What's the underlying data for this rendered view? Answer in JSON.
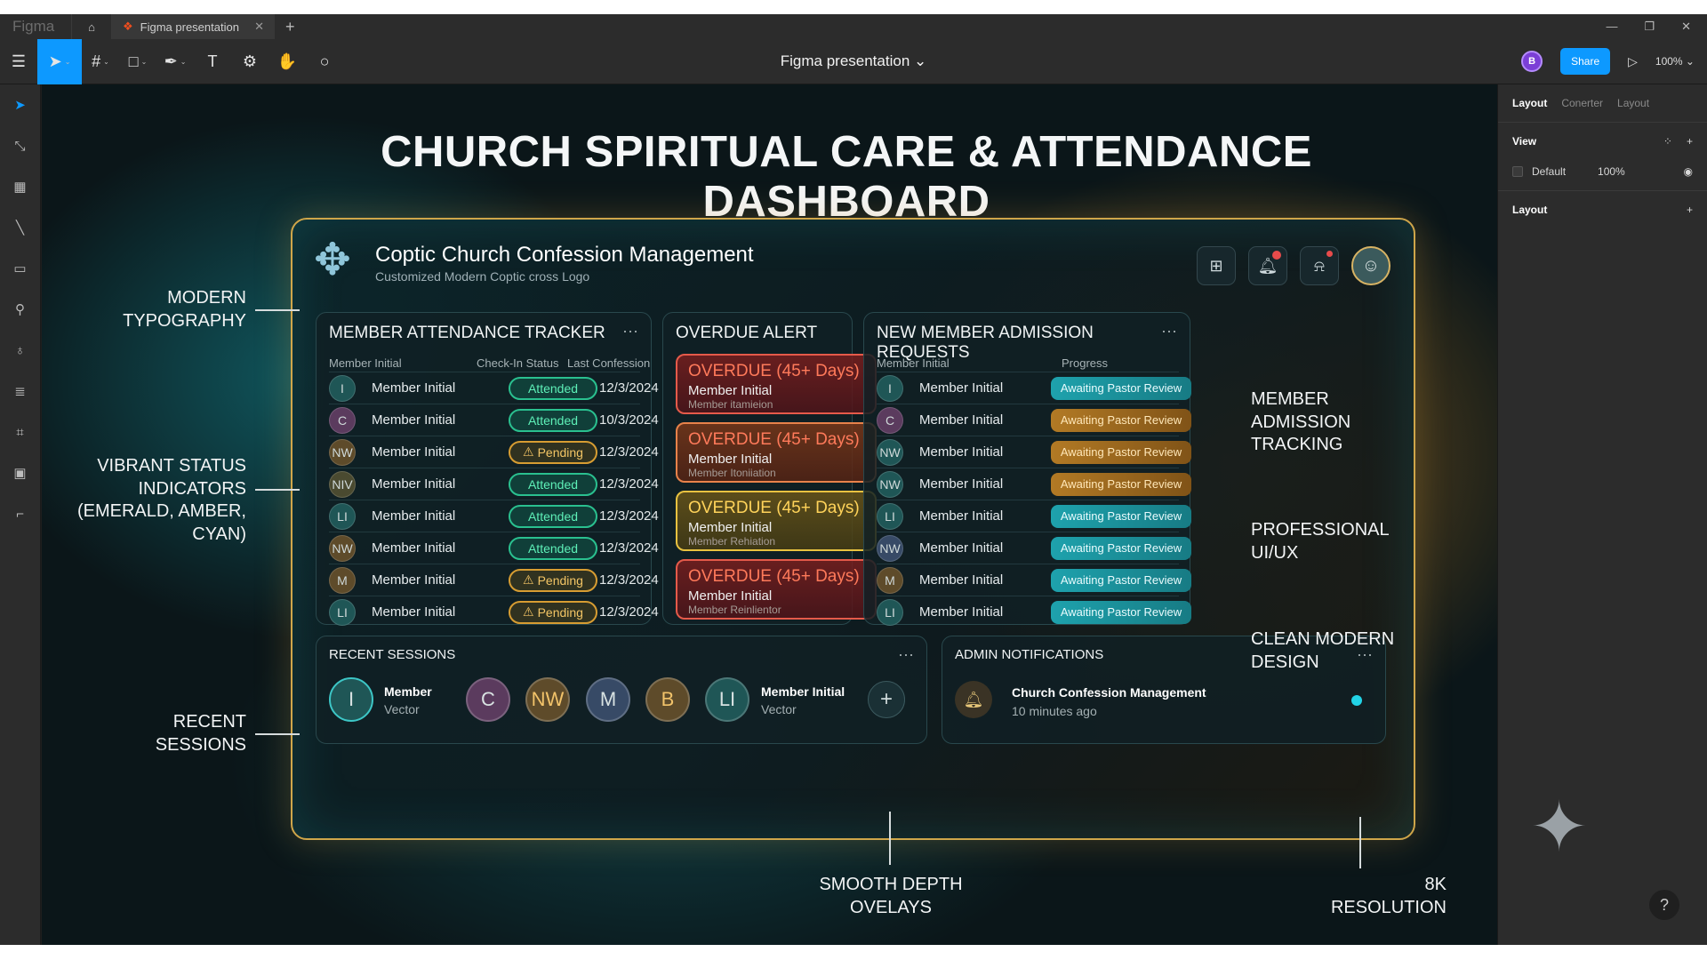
{
  "titlebar": {
    "logo": "Figma",
    "tab": "Figma presentation",
    "tab_close": "✕",
    "new_tab": "+",
    "minimize": "—",
    "maximize": "❐",
    "close": "✕"
  },
  "toolbar": {
    "doc_title": "Figma presentation ⌄",
    "user_initial": "B",
    "share": "Share",
    "play": "▷",
    "zoom": "100% ⌄"
  },
  "right_panel": {
    "tabs": [
      "Layout",
      "Conerter",
      "Layout"
    ],
    "view_label": "View",
    "default_label": "Default",
    "default_value": "100%",
    "layout_label": "Layout",
    "help": "?"
  },
  "canvas": {
    "main_title": "CHURCH SPIRITUAL CARE & ATTENDANCE DASHBOARD",
    "header": {
      "title": "Coptic Church Confession Management",
      "subtitle": "Customized Modern Coptic cross Logo"
    },
    "attendance": {
      "title": "MEMBER ATTENDANCE TRACKER",
      "col_member": "Member Initial",
      "col_status": "Check-In Status",
      "col_date": "Last Confession",
      "rows": [
        {
          "initial": "I",
          "name": "Member Initial",
          "status": "Attended",
          "date": "12/3/2024"
        },
        {
          "initial": "C",
          "name": "Member Initial",
          "status": "Attended",
          "date": "10/3/2024"
        },
        {
          "initial": "NW",
          "name": "Member Initial",
          "status": "Pending",
          "date": "12/3/2024"
        },
        {
          "initial": "NIV",
          "name": "Member Initial",
          "status": "Attended",
          "date": "12/3/2024"
        },
        {
          "initial": "LI",
          "name": "Member Initial",
          "status": "Attended",
          "date": "12/3/2024"
        },
        {
          "initial": "NW",
          "name": "Member Initial",
          "status": "Attended",
          "date": "12/3/2024"
        },
        {
          "initial": "M",
          "name": "Member Initial",
          "status": "Pending",
          "date": "12/3/2024"
        },
        {
          "initial": "LI",
          "name": "Member Initial",
          "status": "Pending",
          "date": "12/3/2024"
        }
      ]
    },
    "overdue": {
      "title": "OVERDUE ALERT",
      "cards": [
        {
          "title": "OVERDUE (45+ Days)",
          "name": "Member Initial",
          "sub": "Member itamieion"
        },
        {
          "title": "OVERDUE (45+ Days)",
          "name": "Member Initial",
          "sub": "Member Itoniiation"
        },
        {
          "title": "OVERDUE (45+ Days)",
          "name": "Member Initial",
          "sub": "Member Rehiation"
        },
        {
          "title": "OVERDUE (45+ Days)",
          "name": "Member Initial",
          "sub": "Member Reinlientor"
        }
      ]
    },
    "admission": {
      "title": "NEW MEMBER ADMISSION REQUESTS",
      "col_member": "Member Initial",
      "col_progress": "Progress",
      "rows": [
        {
          "initial": "I",
          "name": "Member Initial",
          "progress": "Awaiting Pastor Review"
        },
        {
          "initial": "C",
          "name": "Member Initial",
          "progress": "Awaiting Pastor Review"
        },
        {
          "initial": "NW",
          "name": "Member Initial",
          "progress": "Awaiting Pastor Review"
        },
        {
          "initial": "NW",
          "name": "Member Initial",
          "progress": "Awaiting Pastor Review"
        },
        {
          "initial": "LI",
          "name": "Member Initial",
          "progress": "Awaiting Pastor Review"
        },
        {
          "initial": "NW",
          "name": "Member Initial",
          "progress": "Awaiting Pastor Review"
        },
        {
          "initial": "M",
          "name": "Member Initial",
          "progress": "Awaiting Pastor Review"
        },
        {
          "initial": "LI",
          "name": "Member Initial",
          "progress": "Awaiting Pastor Review"
        }
      ]
    },
    "recent": {
      "title": "RECENT SESSIONS",
      "first_initial": "I",
      "first_name": "Member",
      "first_sub": "Vector",
      "avatars": [
        "C",
        "NW",
        "M",
        "B",
        "LI"
      ],
      "last_name": "Member Initial",
      "last_sub": "Vector",
      "add": "+"
    },
    "notifications": {
      "title": "ADMIN NOTIFICATIONS",
      "item_title": "Church Confession Management",
      "item_time": "10 minutes ago"
    },
    "more": "···",
    "callouts": {
      "typography": "MODERN\nTYPOGRAPHY",
      "status": "VIBRANT STATUS\nINDICATORS\n(EMERALD, AMBER,\nCYAN)",
      "recent": "RECENT\nSESSIONS",
      "admission": "MEMBER\nADMISSION\nTRACKING",
      "professional": "PROFESSIONAL\nUI/UX",
      "clean": "CLEAN MODERN\nDESIGN",
      "depth": "SMOOTH DEPTH\nOVELAYS",
      "resolution": "8K\nRESOLUTION"
    }
  },
  "colors": {
    "accent": "#0d99ff",
    "emerald": "#2ac08f",
    "amber": "#d79d32",
    "cyan": "#22d3e6",
    "overdue_red": "#e55a4a",
    "gold_border": "#cfa64a"
  }
}
